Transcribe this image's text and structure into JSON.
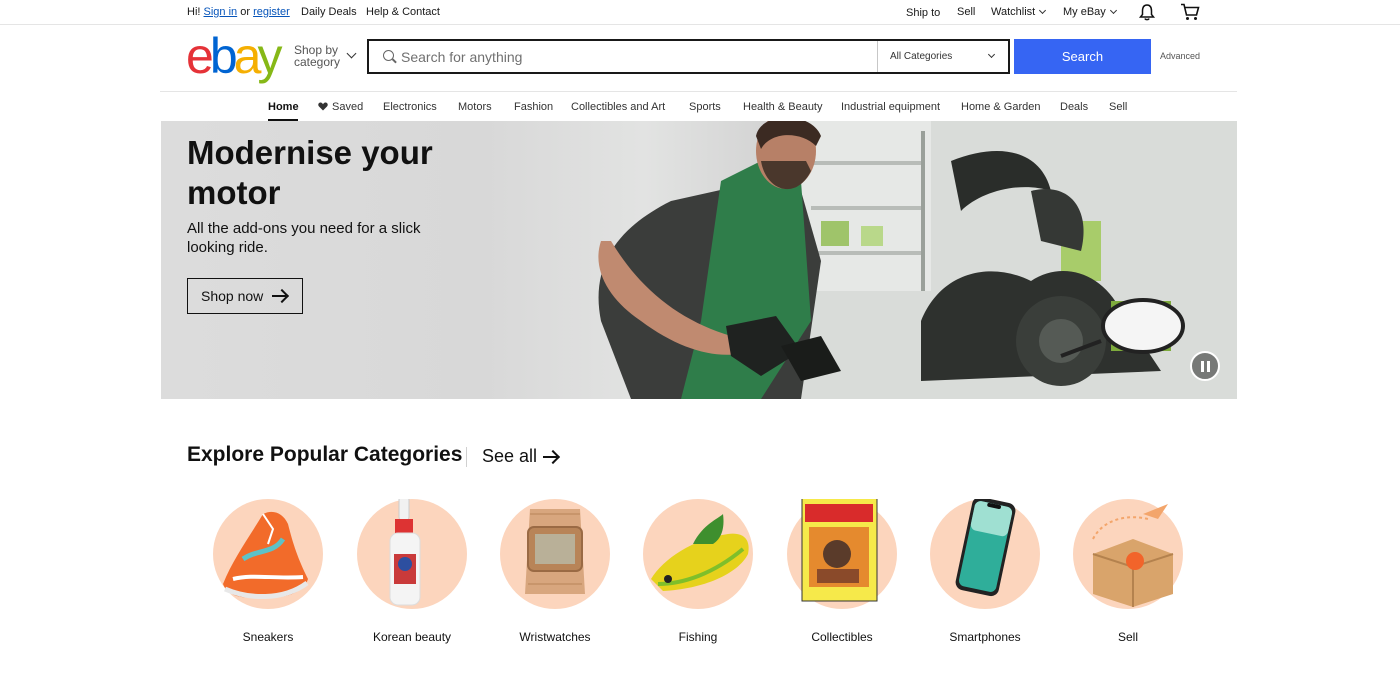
{
  "topbar": {
    "greeting": "Hi!",
    "sign_in": "Sign in",
    "or": "or",
    "register": "register",
    "daily_deals": "Daily Deals",
    "help_contact": "Help & Contact",
    "ship_to": "Ship to",
    "sell": "Sell",
    "watchlist": "Watchlist",
    "my_ebay": "My eBay"
  },
  "header": {
    "logo_letters": [
      "e",
      "b",
      "a",
      "y"
    ],
    "logo_colors": [
      "#e53238",
      "#0064d2",
      "#f5af02",
      "#86b817"
    ],
    "shop_by_category": "Shop by category",
    "search_placeholder": "Search for anything",
    "category_select": "All Categories",
    "search_button": "Search",
    "advanced": "Advanced"
  },
  "nav": {
    "items": [
      "Home",
      "Saved",
      "Electronics",
      "Motors",
      "Fashion",
      "Collectibles and Art",
      "Sports",
      "Health & Beauty",
      "Industrial equipment",
      "Home & Garden",
      "Deals",
      "Sell"
    ],
    "active": "Home"
  },
  "hero": {
    "title": "Modernise your motor",
    "subtitle": "All the add-ons you need for a slick looking ride.",
    "cta": "Shop now"
  },
  "explore": {
    "title": "Explore Popular Categories",
    "see_all": "See all",
    "categories": [
      "Sneakers",
      "Korean beauty",
      "Wristwatches",
      "Fishing",
      "Collectibles",
      "Smartphones",
      "Sell"
    ]
  },
  "colors": {
    "accent": "#3665f3",
    "link": "#0654ba",
    "category_circle": "#fcd5bd"
  },
  "icons": [
    "search-icon",
    "bell-icon",
    "cart-icon",
    "heart-icon",
    "pause-icon",
    "arrow-right-icon",
    "chevron-down-icon"
  ]
}
